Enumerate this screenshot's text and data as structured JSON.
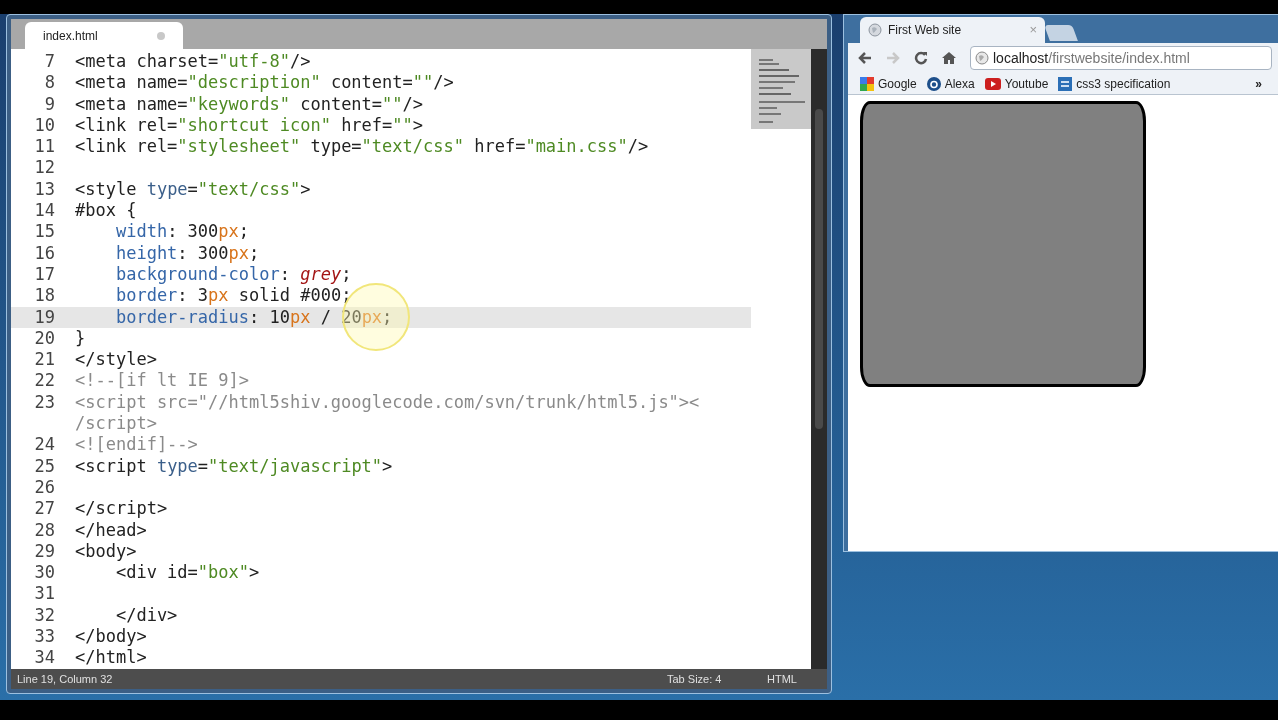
{
  "editor": {
    "tab": {
      "title": "index.html",
      "modified": true
    },
    "lines": [
      {
        "number": "7",
        "current": false,
        "tokens": [
          {
            "text": "<meta charset=",
            "kind": "plain"
          },
          {
            "text": "\"utf-8\"",
            "kind": "str"
          },
          {
            "text": "/>",
            "kind": "plain"
          }
        ]
      },
      {
        "number": "8",
        "current": false,
        "tokens": [
          {
            "text": "<meta name=",
            "kind": "plain"
          },
          {
            "text": "\"description\"",
            "kind": "str"
          },
          {
            "text": " content=",
            "kind": "plain"
          },
          {
            "text": "\"\"",
            "kind": "str"
          },
          {
            "text": "/>",
            "kind": "plain"
          }
        ]
      },
      {
        "number": "9",
        "current": false,
        "tokens": [
          {
            "text": "<meta name=",
            "kind": "plain"
          },
          {
            "text": "\"keywords\"",
            "kind": "str"
          },
          {
            "text": " content=",
            "kind": "plain"
          },
          {
            "text": "\"\"",
            "kind": "str"
          },
          {
            "text": "/>",
            "kind": "plain"
          }
        ]
      },
      {
        "number": "10",
        "current": false,
        "tokens": [
          {
            "text": "<link rel=",
            "kind": "plain"
          },
          {
            "text": "\"shortcut icon\"",
            "kind": "str"
          },
          {
            "text": " href=",
            "kind": "plain"
          },
          {
            "text": "\"\"",
            "kind": "str"
          },
          {
            "text": ">",
            "kind": "plain"
          }
        ]
      },
      {
        "number": "11",
        "current": false,
        "tokens": [
          {
            "text": "<link rel=",
            "kind": "plain"
          },
          {
            "text": "\"stylesheet\"",
            "kind": "str"
          },
          {
            "text": " type=",
            "kind": "plain"
          },
          {
            "text": "\"text/css\"",
            "kind": "str"
          },
          {
            "text": " href=",
            "kind": "plain"
          },
          {
            "text": "\"main.css\"",
            "kind": "str"
          },
          {
            "text": "/>",
            "kind": "plain"
          }
        ]
      },
      {
        "number": "12",
        "current": false
      },
      {
        "number": "13",
        "current": false,
        "tokens": [
          {
            "text": "<style ",
            "kind": "plain"
          },
          {
            "text": "type",
            "kind": "attr"
          },
          {
            "text": "=",
            "kind": "plain"
          },
          {
            "text": "\"text/css\"",
            "kind": "str"
          },
          {
            "text": ">",
            "kind": "plain"
          }
        ]
      },
      {
        "number": "14",
        "current": false,
        "tokens": [
          {
            "text": "#box {",
            "kind": "plain"
          }
        ]
      },
      {
        "number": "15",
        "current": false,
        "tokens": [
          {
            "text": "    width",
            "kind": "prop"
          },
          {
            "text": ": 300",
            "kind": "plain"
          },
          {
            "text": "px",
            "kind": "unit"
          },
          {
            "text": ";",
            "kind": "plain"
          }
        ]
      },
      {
        "number": "16",
        "current": false,
        "tokens": [
          {
            "text": "    height",
            "kind": "prop"
          },
          {
            "text": ": 300",
            "kind": "plain"
          },
          {
            "text": "px",
            "kind": "unit"
          },
          {
            "text": ";",
            "kind": "plain"
          }
        ]
      },
      {
        "number": "17",
        "current": false,
        "tokens": [
          {
            "text": "    background-color",
            "kind": "prop"
          },
          {
            "text": ": ",
            "kind": "plain"
          },
          {
            "text": "grey",
            "kind": "val"
          },
          {
            "text": ";",
            "kind": "plain"
          }
        ]
      },
      {
        "number": "18",
        "current": false,
        "tokens": [
          {
            "text": "    border",
            "kind": "prop"
          },
          {
            "text": ": 3",
            "kind": "plain"
          },
          {
            "text": "px",
            "kind": "unit"
          },
          {
            "text": " solid #000;",
            "kind": "plain"
          }
        ]
      },
      {
        "number": "19",
        "current": true,
        "tokens": [
          {
            "text": "    border-radius",
            "kind": "prop"
          },
          {
            "text": ": 10",
            "kind": "plain"
          },
          {
            "text": "px",
            "kind": "unit"
          },
          {
            "text": " / 20",
            "kind": "plain"
          },
          {
            "text": "px",
            "kind": "unit"
          },
          {
            "text": ";",
            "kind": "plain"
          }
        ]
      },
      {
        "number": "20",
        "current": false,
        "tokens": [
          {
            "text": "}",
            "kind": "plain"
          }
        ]
      },
      {
        "number": "21",
        "current": false,
        "tokens": [
          {
            "text": "</style>",
            "kind": "plain"
          }
        ]
      },
      {
        "number": "22",
        "current": false,
        "tokens": [
          {
            "text": "<!--[if lt IE 9]>",
            "kind": "comment"
          }
        ]
      },
      {
        "number": "23",
        "current": false,
        "tokens": [
          {
            "text": "<script src=\"//html5shiv.googlecode.com/svn/trunk/html5.js\"><",
            "kind": "comment"
          }
        ]
      },
      {
        "current": false,
        "tokens": [
          {
            "text": "/script>",
            "kind": "comment"
          }
        ]
      },
      {
        "number": "24",
        "current": false,
        "tokens": [
          {
            "text": "<![endif]-->",
            "kind": "comment"
          }
        ]
      },
      {
        "number": "25",
        "current": false,
        "tokens": [
          {
            "text": "<script ",
            "kind": "plain"
          },
          {
            "text": "type",
            "kind": "attr"
          },
          {
            "text": "=",
            "kind": "plain"
          },
          {
            "text": "\"text/javascript\"",
            "kind": "str"
          },
          {
            "text": ">",
            "kind": "plain"
          }
        ]
      },
      {
        "number": "26",
        "current": false
      },
      {
        "number": "27",
        "current": false,
        "tokens": [
          {
            "text": "</script>",
            "kind": "plain"
          }
        ]
      },
      {
        "number": "28",
        "current": false,
        "tokens": [
          {
            "text": "</head>",
            "kind": "plain"
          }
        ]
      },
      {
        "number": "29",
        "current": false,
        "tokens": [
          {
            "text": "<body>",
            "kind": "plain"
          }
        ]
      },
      {
        "number": "30",
        "current": false,
        "tokens": [
          {
            "text": "    <div id=",
            "kind": "plain"
          },
          {
            "text": "\"box\"",
            "kind": "str"
          },
          {
            "text": ">",
            "kind": "plain"
          }
        ]
      },
      {
        "number": "31",
        "current": false
      },
      {
        "number": "32",
        "current": false,
        "tokens": [
          {
            "text": "    </div>",
            "kind": "plain"
          }
        ]
      },
      {
        "number": "33",
        "current": false,
        "tokens": [
          {
            "text": "</body>",
            "kind": "plain"
          }
        ]
      },
      {
        "number": "34",
        "current": false,
        "tokens": [
          {
            "text": "</html>",
            "kind": "plain"
          }
        ]
      }
    ],
    "status_bar": {
      "position": "Line 19, Column 32",
      "tab_size": "Tab Size: 4",
      "syntax": "HTML"
    }
  },
  "browser": {
    "tab": {
      "title": "First Web site",
      "close": "×"
    },
    "address": {
      "host": "localhost",
      "path": "/firstwebsite/index.html"
    },
    "bookmarks": [
      {
        "label": "Google"
      },
      {
        "label": "Alexa"
      },
      {
        "label": "Youtube"
      },
      {
        "label": "css3 specification"
      }
    ],
    "overflow": "»"
  }
}
